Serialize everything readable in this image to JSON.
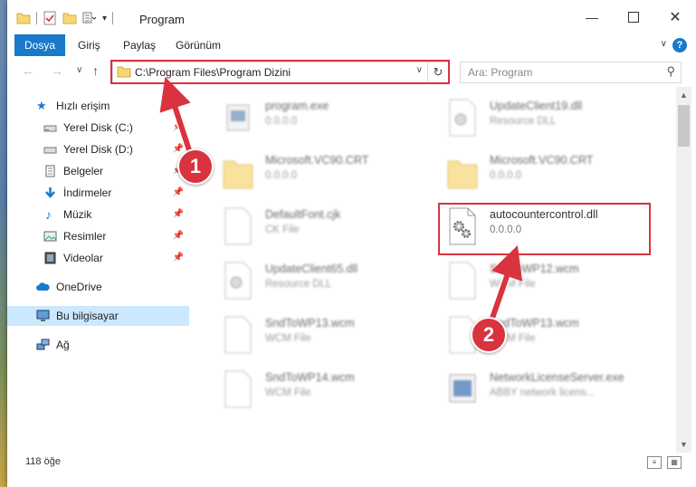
{
  "window": {
    "title": "Program"
  },
  "ribbon": {
    "tabs": [
      "Dosya",
      "Giriş",
      "Paylaş",
      "Görünüm"
    ]
  },
  "address": {
    "path": "C:\\Program Files\\Program Dizini"
  },
  "search": {
    "placeholder": "Ara: Program"
  },
  "sidebar": {
    "items": [
      {
        "label": "Hızlı erişim",
        "icon": "star-icon"
      },
      {
        "label": "Yerel Disk (C:)",
        "icon": "drive-icon"
      },
      {
        "label": "Yerel Disk (D:)",
        "icon": "drive-icon"
      },
      {
        "label": "Belgeler",
        "icon": "documents-icon"
      },
      {
        "label": "İndirmeler",
        "icon": "download-icon"
      },
      {
        "label": "Müzik",
        "icon": "music-icon"
      },
      {
        "label": "Resimler",
        "icon": "pictures-icon"
      },
      {
        "label": "Videolar",
        "icon": "video-icon"
      },
      {
        "label": "OneDrive",
        "icon": "cloud-icon"
      },
      {
        "label": "Bu bilgisayar",
        "icon": "computer-icon"
      },
      {
        "label": "Ağ",
        "icon": "network-icon"
      }
    ]
  },
  "files": [
    {
      "name": "program.exe",
      "desc": "0.0.0.0"
    },
    {
      "name": "UpdateClient19.dll",
      "desc": "Resource DLL"
    },
    {
      "name": "Microsoft.VC90.CRT",
      "desc": "0.0.0.0"
    },
    {
      "name": "Microsoft.VC90.CRT",
      "desc": "0.0.0.0"
    },
    {
      "name": "DefaultFont.cjk",
      "desc": "CK File"
    },
    {
      "name": "autocountercontrol.dll",
      "desc": "0.0.0.0"
    },
    {
      "name": "UpdateClient65.dll",
      "desc": "Resource DLL"
    },
    {
      "name": "SndToWP12.wcm",
      "desc": "WCM File"
    },
    {
      "name": "SndToWP13.wcm",
      "desc": "WCM File"
    },
    {
      "name": "SndToWP13.wcm",
      "desc": "WCM File"
    },
    {
      "name": "SndToWP14.wcm",
      "desc": "WCM File"
    },
    {
      "name": "NetworkLicenseServer.exe",
      "desc": "ABBY network licens..."
    }
  ],
  "status": {
    "count": "118 öğe"
  },
  "annotations": {
    "one": "1",
    "two": "2"
  },
  "colors": {
    "accent": "#1979ca",
    "highlight": "#d9333f"
  }
}
